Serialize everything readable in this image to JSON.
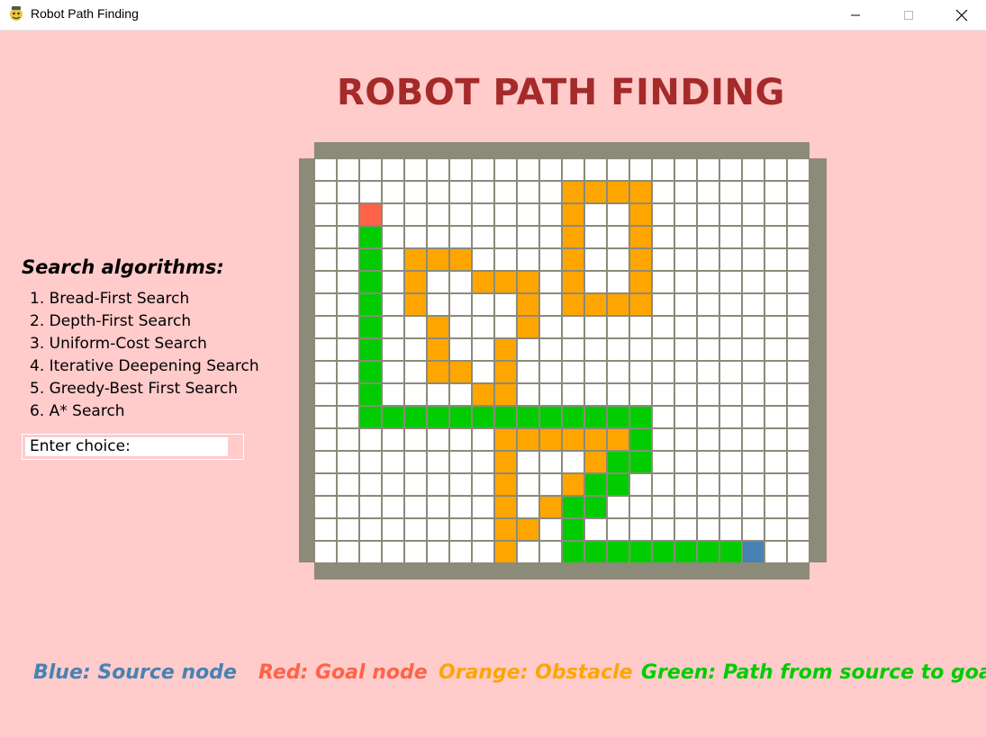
{
  "window": {
    "title": "Robot Path Finding"
  },
  "heading": "ROBOT PATH FINDING",
  "algorithms": {
    "heading": "Search algorithms:",
    "items": [
      "1. Bread-First Search",
      "2. Depth-First Search",
      "3. Uniform-Cost Search",
      "4. Iterative Deepening Search",
      "5. Greedy-Best First Search",
      "6. A* Search"
    ]
  },
  "choice": {
    "label": "Enter choice:"
  },
  "legend": {
    "source": "Blue: Source node",
    "goal": "Red: Goal node",
    "obstacle": "Orange: Obstacle",
    "path": "Green: Path from source to goal"
  },
  "colors": {
    "background": "#ffcbcb",
    "title": "#a52a2a",
    "source": "#4682b4",
    "goal": "#ff6347",
    "obstacle": "#ffa500",
    "path": "#00cc00",
    "border": "#8c8a79"
  },
  "grid": {
    "cols": 22,
    "rows": 18,
    "goal": [
      2,
      2
    ],
    "source": [
      19,
      17
    ],
    "obstacles": [
      [
        11,
        1
      ],
      [
        12,
        1
      ],
      [
        13,
        1
      ],
      [
        14,
        1
      ],
      [
        11,
        2
      ],
      [
        14,
        2
      ],
      [
        11,
        3
      ],
      [
        14,
        3
      ],
      [
        11,
        4
      ],
      [
        14,
        4
      ],
      [
        11,
        5
      ],
      [
        14,
        5
      ],
      [
        11,
        6
      ],
      [
        12,
        6
      ],
      [
        13,
        6
      ],
      [
        14,
        6
      ],
      [
        4,
        4
      ],
      [
        5,
        4
      ],
      [
        6,
        4
      ],
      [
        4,
        5
      ],
      [
        7,
        5
      ],
      [
        8,
        5
      ],
      [
        9,
        5
      ],
      [
        4,
        6
      ],
      [
        9,
        6
      ],
      [
        5,
        7
      ],
      [
        9,
        7
      ],
      [
        5,
        8
      ],
      [
        8,
        8
      ],
      [
        5,
        9
      ],
      [
        6,
        9
      ],
      [
        8,
        9
      ],
      [
        7,
        10
      ],
      [
        8,
        10
      ],
      [
        8,
        12
      ],
      [
        9,
        12
      ],
      [
        10,
        12
      ],
      [
        11,
        12
      ],
      [
        12,
        12
      ],
      [
        13,
        12
      ],
      [
        8,
        13
      ],
      [
        12,
        13
      ],
      [
        8,
        14
      ],
      [
        11,
        14
      ],
      [
        8,
        15
      ],
      [
        10,
        15
      ],
      [
        8,
        16
      ],
      [
        9,
        16
      ],
      [
        8,
        17
      ]
    ],
    "path": [
      [
        2,
        3
      ],
      [
        2,
        4
      ],
      [
        2,
        5
      ],
      [
        2,
        6
      ],
      [
        2,
        7
      ],
      [
        2,
        8
      ],
      [
        2,
        9
      ],
      [
        2,
        10
      ],
      [
        2,
        11
      ],
      [
        3,
        11
      ],
      [
        4,
        11
      ],
      [
        5,
        11
      ],
      [
        6,
        11
      ],
      [
        7,
        11
      ],
      [
        8,
        11
      ],
      [
        9,
        11
      ],
      [
        10,
        11
      ],
      [
        11,
        11
      ],
      [
        12,
        11
      ],
      [
        13,
        11
      ],
      [
        14,
        11
      ],
      [
        14,
        12
      ],
      [
        14,
        13
      ],
      [
        13,
        13
      ],
      [
        13,
        14
      ],
      [
        12,
        14
      ],
      [
        12,
        15
      ],
      [
        11,
        15
      ],
      [
        11,
        16
      ],
      [
        11,
        17
      ],
      [
        12,
        17
      ],
      [
        13,
        17
      ],
      [
        14,
        17
      ],
      [
        15,
        17
      ],
      [
        16,
        17
      ],
      [
        17,
        17
      ],
      [
        18,
        17
      ]
    ]
  }
}
